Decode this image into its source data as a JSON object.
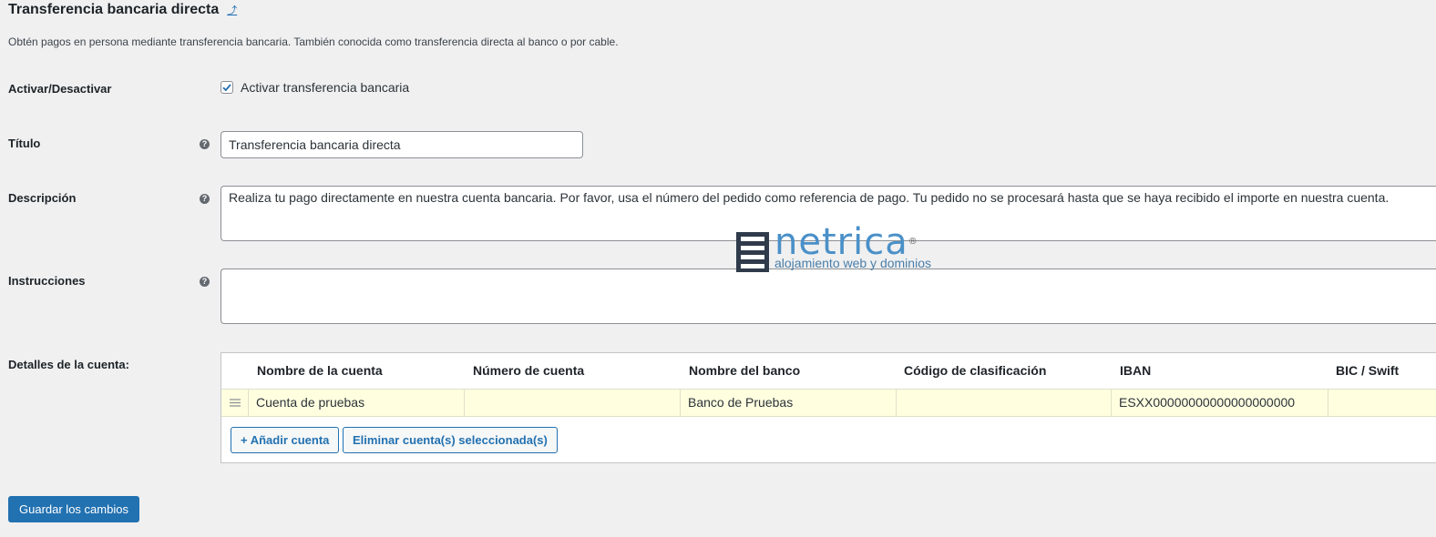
{
  "header": {
    "title": "Transferencia bancaria directa",
    "back_link_icon": "return-up-arrow-icon",
    "description": "Obtén pagos en persona mediante transferencia bancaria. También conocida como transferencia directa al banco o por cable."
  },
  "fields": {
    "enable": {
      "label": "Activar/Desactivar",
      "checkbox_label": "Activar transferencia bancaria",
      "checked": true
    },
    "title": {
      "label": "Título",
      "help_icon": "question-mark-icon",
      "value": "Transferencia bancaria directa"
    },
    "description": {
      "label": "Descripción",
      "help_icon": "question-mark-icon",
      "value": "Realiza tu pago directamente en nuestra cuenta bancaria. Por favor, usa el número del pedido como referencia de pago. Tu pedido no se procesará hasta que se haya recibido el importe en nuestra cuenta."
    },
    "instructions": {
      "label": "Instrucciones",
      "help_icon": "question-mark-icon",
      "value": ""
    }
  },
  "accounts": {
    "label": "Detalles de la cuenta:",
    "columns": [
      "Nombre de la cuenta",
      "Número de cuenta",
      "Nombre del banco",
      "Código de clasificación",
      "IBAN",
      "BIC / Swift"
    ],
    "rows": [
      [
        "Cuenta de pruebas",
        "",
        "Banco de Pruebas",
        "",
        "ESXX00000000000000000000",
        ""
      ]
    ],
    "add_button": "+ Añadir cuenta",
    "remove_button": "Eliminar cuenta(s) seleccionada(s)",
    "row_highlight_color": "#ffffe0"
  },
  "watermark": {
    "brand": "netrica",
    "registered": "®",
    "tagline": "alojamiento web y dominios"
  },
  "footer": {
    "save_button": "Guardar los cambios"
  },
  "colors": {
    "accent": "#2271b1",
    "background": "#f0f0f1",
    "brand": "#4a90c8"
  }
}
